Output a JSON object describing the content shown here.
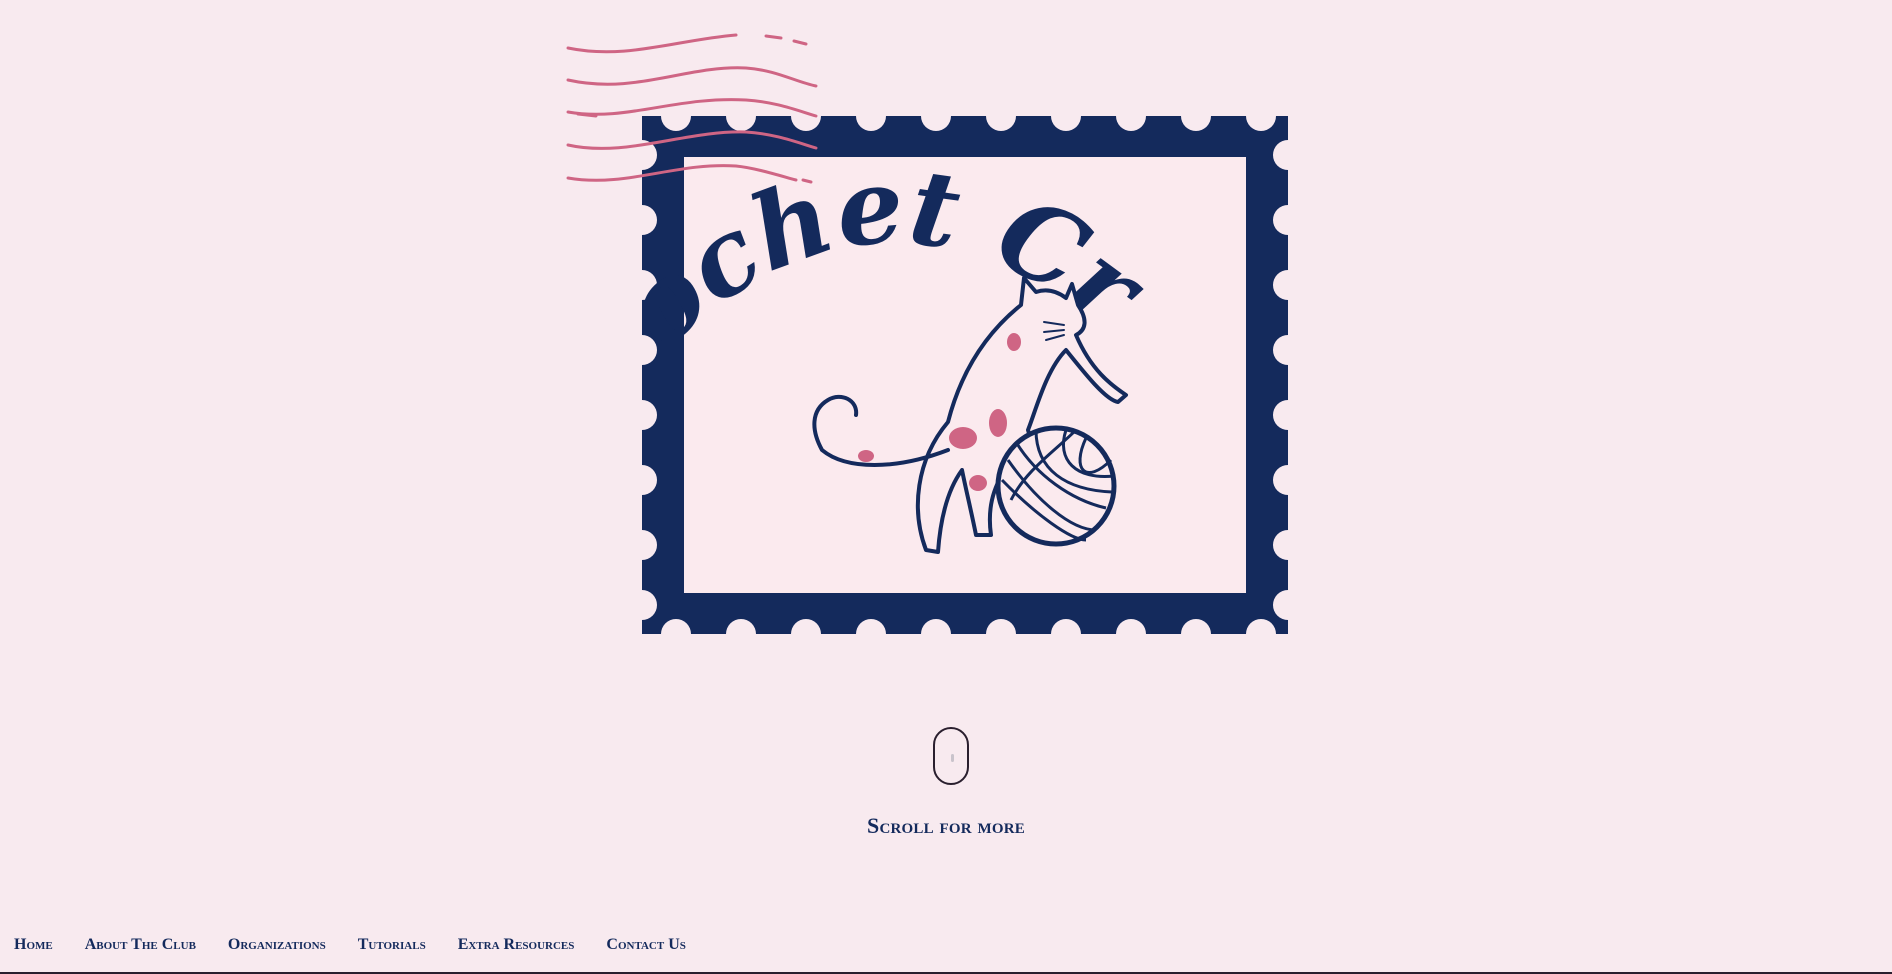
{
  "logo": {
    "brand_name": "Crochet Crew",
    "icon": "stamp-cat-yarn-logo",
    "colors": {
      "navy": "#142a5c",
      "pink": "#cf6584",
      "paper": "#fbeaee"
    }
  },
  "scroll": {
    "icon": "mouse-scroll-icon",
    "label": "Scroll for more"
  },
  "nav": {
    "items": [
      {
        "label": "Home"
      },
      {
        "label": "About The Club"
      },
      {
        "label": "Organizations"
      },
      {
        "label": "Tutorials"
      },
      {
        "label": "Extra Resources"
      },
      {
        "label": "Contact Us"
      }
    ]
  }
}
